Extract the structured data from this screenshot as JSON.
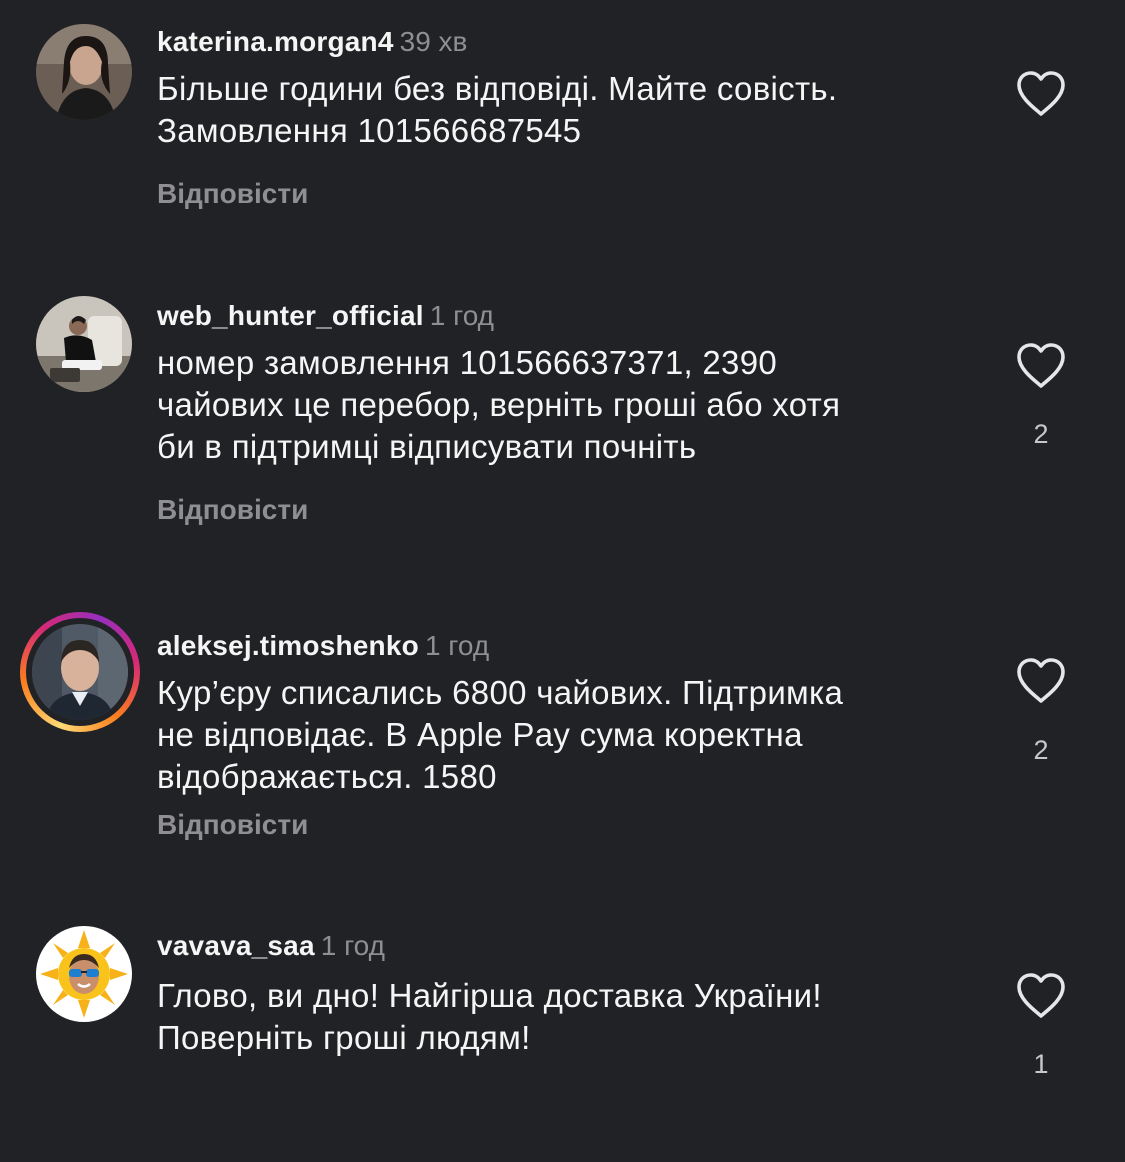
{
  "comments": [
    {
      "username": "katerina.morgan4",
      "time": "39 хв",
      "text_lines": [
        "Більше години без відповіді. Майте совість.",
        "Замовлення  101566687545"
      ],
      "reply_label": "Відповісти",
      "likes": "",
      "avatar_icon": "avatar-photo-woman",
      "story_ring": false
    },
    {
      "username": "web_hunter_official",
      "time": "1 год",
      "text_lines": [
        "номер замовлення 101566637371, 2390",
        "чайових це перебор, верніть гроші або хотя",
        "би в підтримці відписувати почніть"
      ],
      "reply_label": "Відповісти",
      "likes": "2",
      "avatar_icon": "avatar-photo-man-sitting",
      "story_ring": false
    },
    {
      "username": "aleksej.timoshenko",
      "time": "1 год",
      "text_lines": [
        "Кур’єру списались 6800 чайових. Підтримка",
        "не відповідає. В Apple Pay сума коректна",
        "відображається. 1580"
      ],
      "reply_label": "Відповісти",
      "likes": "2",
      "avatar_icon": "avatar-photo-man-portrait",
      "story_ring": true
    },
    {
      "username": "vavava_saa",
      "time": "1 год",
      "text_lines": [
        "Глово, ви дно! Найгірша доставка України!",
        "Поверніть гроші людям!"
      ],
      "reply_label": "",
      "likes": "1",
      "avatar_icon": "avatar-sun-emoji",
      "story_ring": false
    }
  ],
  "colors": {
    "background": "#202225",
    "text": "#f5f5f5",
    "secondary": "#8e8e93",
    "story_ring": [
      "#feda75",
      "#fa7e1e",
      "#d62976",
      "#962fbf"
    ]
  }
}
